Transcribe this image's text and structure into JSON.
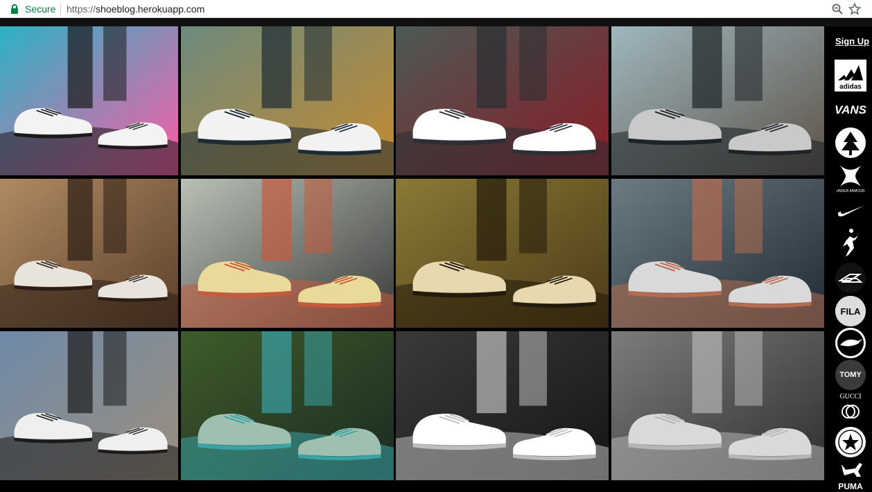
{
  "browser": {
    "secure_label": "Secure",
    "url_scheme": "https://",
    "url_host": "shoeblog.herokuapp.com"
  },
  "sidebar": {
    "signup_label": "Sign Up",
    "brands": [
      {
        "name": "adidas",
        "text": "adidas"
      },
      {
        "name": "vans",
        "text": "VANS"
      },
      {
        "name": "timberland",
        "text": ""
      },
      {
        "name": "under-armour",
        "text": "UNDER ARMOUR"
      },
      {
        "name": "nike",
        "text": ""
      },
      {
        "name": "jordan",
        "text": ""
      },
      {
        "name": "reebok",
        "text": ""
      },
      {
        "name": "fila",
        "text": "FILA"
      },
      {
        "name": "lacoste",
        "text": ""
      },
      {
        "name": "tommy",
        "text": "TOMY"
      },
      {
        "name": "gucci",
        "text": "GUCCI"
      },
      {
        "name": "converse",
        "text": "CONVERSE ALL STAR"
      },
      {
        "name": "puma",
        "text": "PUMA"
      }
    ]
  },
  "gallery": {
    "tiles": [
      {
        "name": "white-sneakers-graffiti",
        "colors": [
          "#2bb3c4",
          "#ff5aa5",
          "#1a1a1a",
          "#f3f3f3"
        ]
      },
      {
        "name": "black-nike-street",
        "colors": [
          "#6d8a7e",
          "#c58a2e",
          "#1d2b35",
          "#f2f2f2"
        ]
      },
      {
        "name": "red-nike-flyknit",
        "colors": [
          "#4b5a55",
          "#8a1a25",
          "#2a2f33",
          "#ffffff"
        ]
      },
      {
        "name": "grey-sneakers-jump",
        "colors": [
          "#9fb7be",
          "#5c5148",
          "#1d2326",
          "#c9c9c9"
        ]
      },
      {
        "name": "worn-vans-sand",
        "colors": [
          "#b08a62",
          "#5a3f2a",
          "#2b1d14",
          "#e8e4dc"
        ]
      },
      {
        "name": "skateboard-vans",
        "colors": [
          "#b9c0b5",
          "#3a3a3a",
          "#c65b3c",
          "#e9d99a"
        ]
      },
      {
        "name": "old-skool-boardwalk",
        "colors": [
          "#8a7a36",
          "#4b3a17",
          "#221a0a",
          "#e8d8b0"
        ]
      },
      {
        "name": "vans-wood-pallet",
        "colors": [
          "#6c7b82",
          "#1f2a34",
          "#b46b4f",
          "#d9d9d9"
        ]
      },
      {
        "name": "adidas-gazelle-brick",
        "colors": [
          "#6f8aa8",
          "#9b8e7d",
          "#1c1c1c",
          "#efefef"
        ]
      },
      {
        "name": "adidas-eqt-box",
        "colors": [
          "#3f5b2a",
          "#1a2a22",
          "#3aa3a6",
          "#9fc0b0"
        ]
      },
      {
        "name": "nmd-monochrome",
        "colors": [
          "#3a3a3a",
          "#151515",
          "#bdbdbd",
          "#ffffff"
        ]
      },
      {
        "name": "yeezy-group",
        "colors": [
          "#7c7c7c",
          "#2e2e2e",
          "#b5b5b5",
          "#d9d9d9"
        ]
      }
    ]
  }
}
